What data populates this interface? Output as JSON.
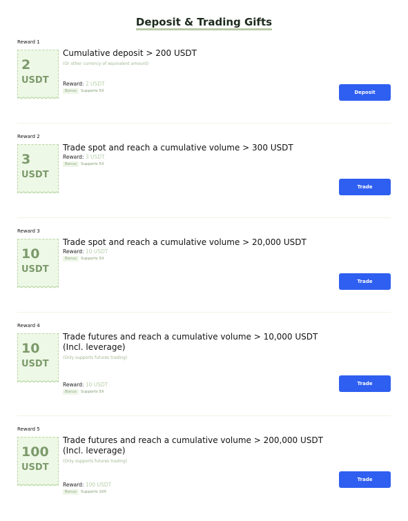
{
  "title": "Deposit & Trading Gifts",
  "rewards": [
    {
      "label": "Reward 1",
      "amount": "2",
      "currency": "USDT",
      "title": "Cumulative deposit > 200 USDT",
      "subtitle": "(Or other currency of equivalent amount)",
      "reward_label": "Reward:",
      "reward_value": "2 USDT",
      "tag1": "Bonus",
      "tag2": "Supports 5X",
      "button": "Deposit"
    },
    {
      "label": "Reward 2",
      "amount": "3",
      "currency": "USDT",
      "title": "Trade spot and reach a cumulative volume > 300 USDT",
      "reward_label": "Reward:",
      "reward_value": "3 USDT",
      "tag1": "Bonus",
      "tag2": "Supports 5X",
      "button": "Trade"
    },
    {
      "label": "Reward 3",
      "amount": "10",
      "currency": "USDT",
      "title": "Trade spot and reach a cumulative volume > 20,000 USDT",
      "reward_label": "Reward:",
      "reward_value": "10 USDT",
      "tag1": "Bonus",
      "tag2": "Supports 5X",
      "button": "Trade"
    },
    {
      "label": "Reward 4",
      "amount": "10",
      "currency": "USDT",
      "title": "Trade futures and reach a cumulative volume > 10,000 USDT (Incl. leverage)",
      "subtitle": "(Only supports futures trading)",
      "reward_label": "Reward:",
      "reward_value": "10 USDT",
      "tag1": "Bonus",
      "tag2": "Supports 5X",
      "button": "Trade"
    },
    {
      "label": "Reward 5",
      "amount": "100",
      "currency": "USDT",
      "title": "Trade futures and reach a cumulative volume > 200,000 USDT (Incl. leverage)",
      "subtitle": "(Only supports futures trading)",
      "reward_label": "Reward:",
      "reward_value": "100 USDT",
      "tag1": "Bonus",
      "tag2": "Supports 10X",
      "button": "Trade"
    }
  ]
}
